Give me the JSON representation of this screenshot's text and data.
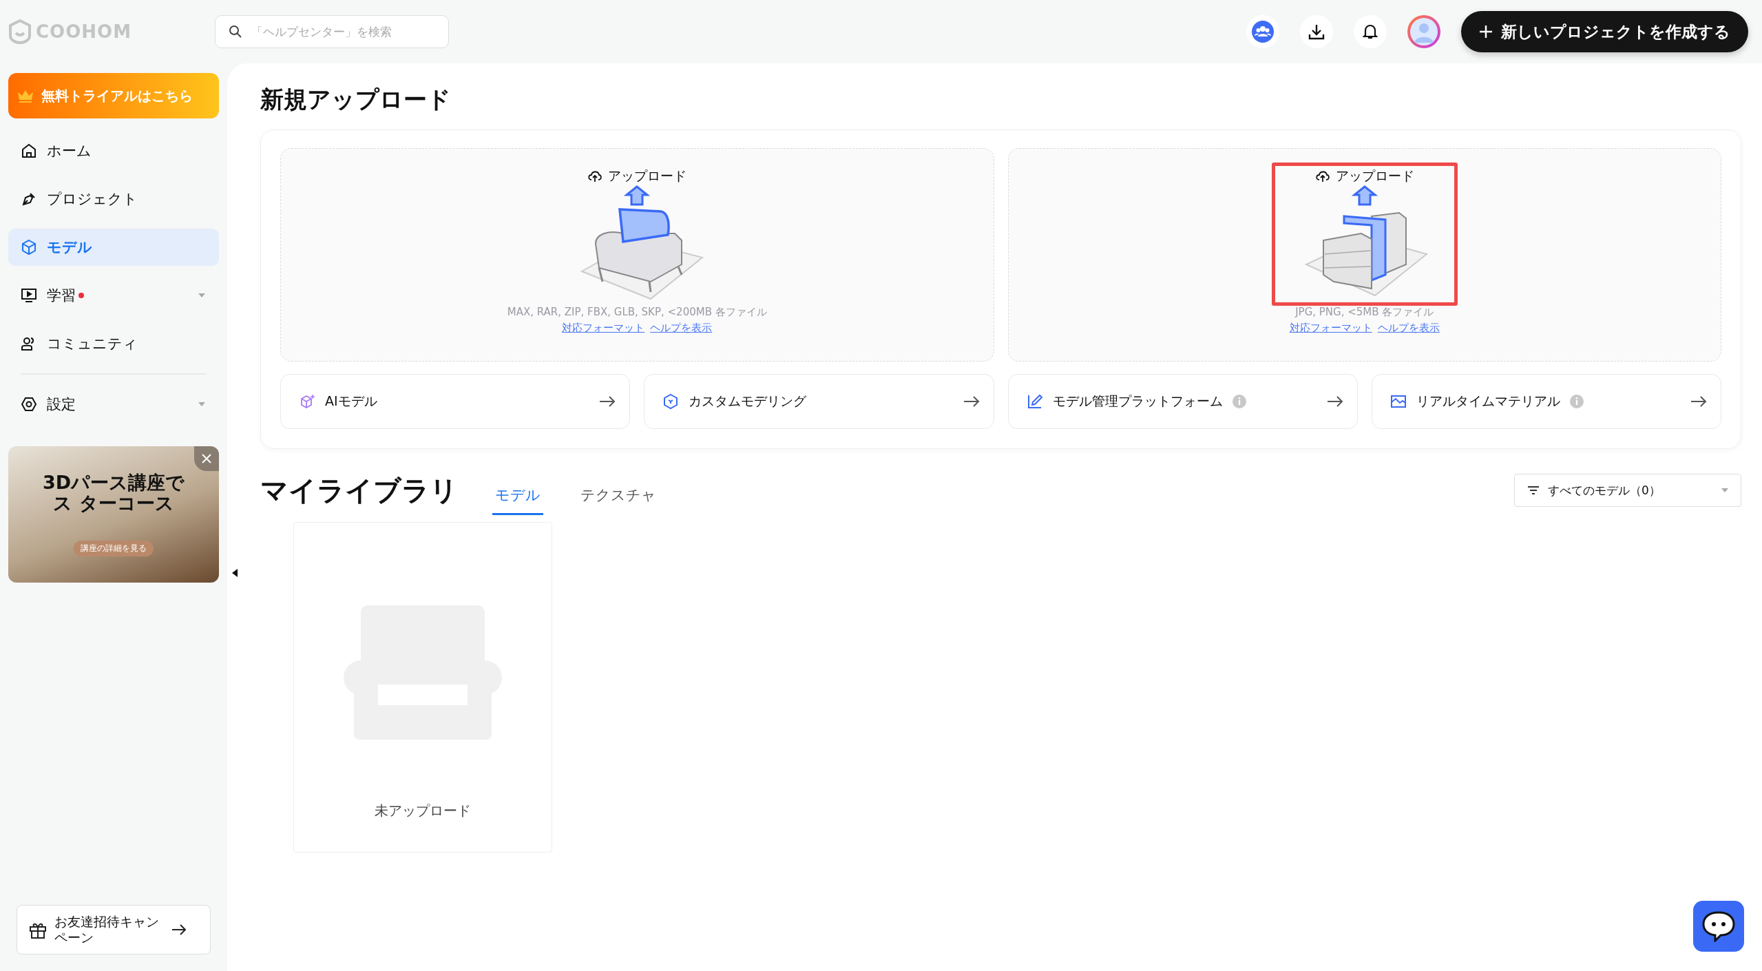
{
  "header": {
    "logo": "COOHOM",
    "search": {
      "placeholder": "「ヘルプセンター」を検索"
    },
    "create_button": "新しいプロジェクトを作成する"
  },
  "sidebar": {
    "trial_button": "無料トライアルはこちら",
    "items": [
      {
        "label": "ホーム",
        "selected": false,
        "dot": false,
        "expandable": false
      },
      {
        "label": "プロジェクト",
        "selected": false,
        "dot": false,
        "expandable": false
      },
      {
        "label": "モデル",
        "selected": true,
        "dot": false,
        "expandable": false
      },
      {
        "label": "学習",
        "selected": false,
        "dot": true,
        "expandable": true
      },
      {
        "label": "コミュニティ",
        "selected": false,
        "dot": false,
        "expandable": false
      }
    ],
    "bottom_items": [
      {
        "label": "設定",
        "selected": false,
        "dot": false,
        "expandable": true
      }
    ],
    "banner": {
      "title": "3Dパース講座でス ターコース",
      "button": "講座の詳細を見る"
    },
    "invite": "お友達招待キャンペーン"
  },
  "new_upload": {
    "title": "新規アップロード",
    "cards": [
      {
        "kind": "furniture",
        "label": "アップロード",
        "formats": "MAX, RAR, ZIP, FBX, GLB, SKP, <200MB 各ファイル",
        "links": [
          "対応フォーマット",
          "ヘルプを表示"
        ],
        "highlighted": false
      },
      {
        "kind": "wall",
        "label": "アップロード",
        "formats": "JPG, PNG, <5MB 各ファイル",
        "links": [
          "対応フォーマット",
          "ヘルプを表示"
        ],
        "highlighted": true
      }
    ],
    "actions": [
      {
        "label": "AIモデル",
        "info": false
      },
      {
        "label": "カスタムモデリング",
        "info": false
      },
      {
        "label": "モデル管理プラットフォーム",
        "info": true
      },
      {
        "label": "リアルタイムマテリアル",
        "info": true
      }
    ]
  },
  "library": {
    "title": "マイライブラリ",
    "tabs": [
      {
        "label": "モデル",
        "selected": true
      },
      {
        "label": "テクスチャ",
        "selected": false
      }
    ],
    "filter": "すべてのモデル（0）",
    "empty_label": "未アップロード"
  }
}
